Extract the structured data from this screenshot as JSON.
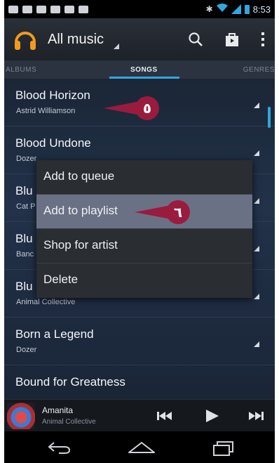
{
  "status_bar": {
    "time": "8:53",
    "notification_icons": [
      "gmail-icon",
      "message-icon",
      "calendar-icon",
      "shopping-bag-icon",
      "shopping-bag-icon",
      "game-icon"
    ],
    "indicators": [
      "bluetooth-icon",
      "wifi-icon",
      "signal-icon",
      "battery-icon"
    ]
  },
  "action_bar": {
    "app_icon": "headphones-icon",
    "title": "All music",
    "actions": [
      "search-icon",
      "shop-icon",
      "overflow-menu-icon"
    ]
  },
  "tabs": {
    "albums": "ALBUMS",
    "songs": "SONGS",
    "genres": "GENRES",
    "active": "SONGS"
  },
  "songs": [
    {
      "title": "Blood Horizon",
      "artist": "Astrid Williamson"
    },
    {
      "title": "Blood Undone",
      "artist": "Dozer"
    },
    {
      "title": "Blu",
      "artist": "Cat P"
    },
    {
      "title": "Blu",
      "artist": "Banc"
    },
    {
      "title": "Blu",
      "artist": "Animal Collective"
    },
    {
      "title": "Born a Legend",
      "artist": "Dozer"
    },
    {
      "title": "Bound for Greatness",
      "artist": ""
    }
  ],
  "context_menu": {
    "items": [
      "Add to queue",
      "Add to playlist",
      "Shop for artist",
      "Delete"
    ],
    "selected": "Add to playlist"
  },
  "callouts": {
    "first": "٥",
    "second": "٦",
    "color": "#9a1b3e"
  },
  "now_playing": {
    "title": "Amanita",
    "artist": "Animal Collective",
    "controls": [
      "previous-icon",
      "play-icon",
      "next-icon"
    ]
  },
  "nav_bar": [
    "back-icon",
    "home-icon",
    "recent-apps-icon"
  ],
  "colors": {
    "accent": "#31a6de",
    "menu_bg": "#2a2d31",
    "menu_selected": "#6a7184"
  }
}
